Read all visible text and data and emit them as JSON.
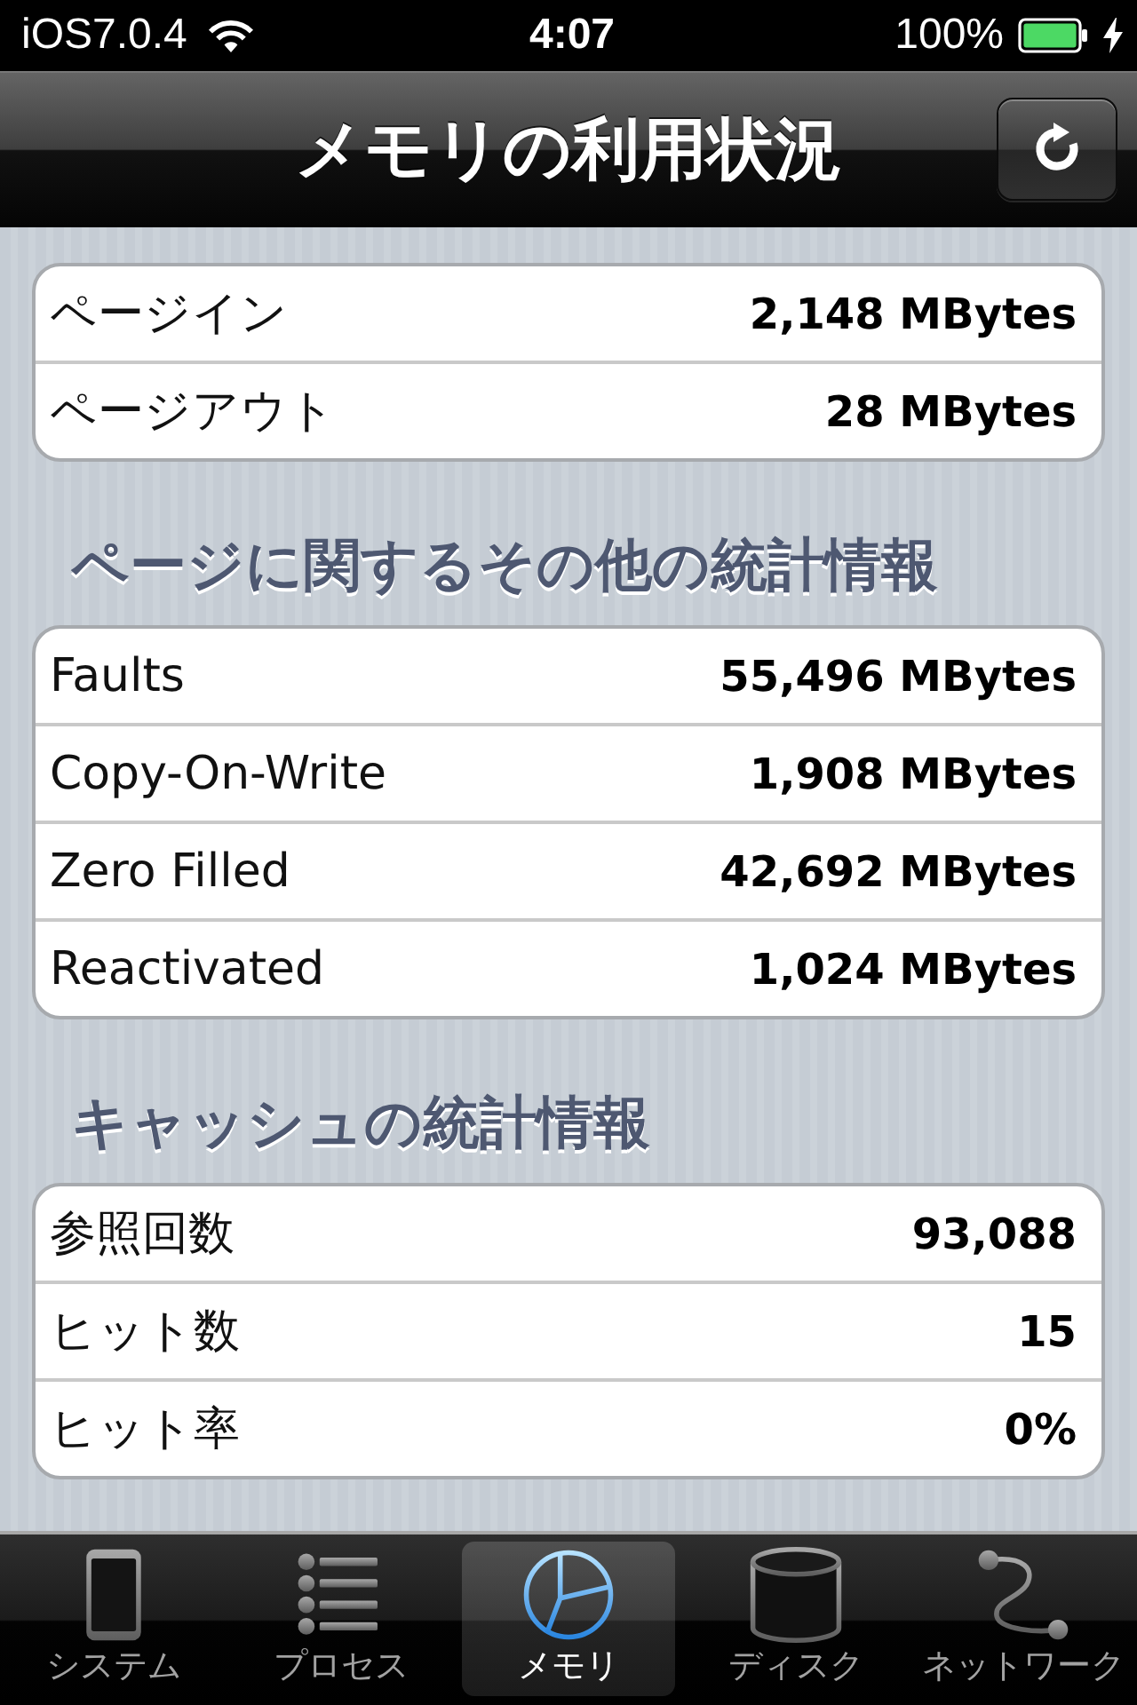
{
  "status_bar": {
    "carrier": "iOS7.0.4",
    "time": "4:07",
    "battery": "100%",
    "charging": true
  },
  "nav_bar": {
    "title": "メモリの利用状況"
  },
  "sections": [
    {
      "rows": [
        {
          "label": "ページイン",
          "value": "2,148 MBytes"
        },
        {
          "label": "ページアウト",
          "value": "28 MBytes"
        }
      ]
    },
    {
      "title": "ページに関するその他の統計情報",
      "rows": [
        {
          "label": "Faults",
          "value": "55,496 MBytes"
        },
        {
          "label": "Copy-On-Write",
          "value": "1,908 MBytes"
        },
        {
          "label": "Zero Filled",
          "value": "42,692 MBytes"
        },
        {
          "label": "Reactivated",
          "value": "1,024 MBytes"
        }
      ]
    },
    {
      "title": "キャッシュの統計情報",
      "rows": [
        {
          "label": "参照回数",
          "value": "93,088"
        },
        {
          "label": "ヒット数",
          "value": "15"
        },
        {
          "label": "ヒット率",
          "value": "0%"
        }
      ]
    }
  ],
  "tabs": [
    {
      "label": "システム",
      "selected": false
    },
    {
      "label": "プロセス",
      "selected": false
    },
    {
      "label": "メモリ",
      "selected": true
    },
    {
      "label": "ディスク",
      "selected": false
    },
    {
      "label": "ネットワーク",
      "selected": false
    }
  ]
}
